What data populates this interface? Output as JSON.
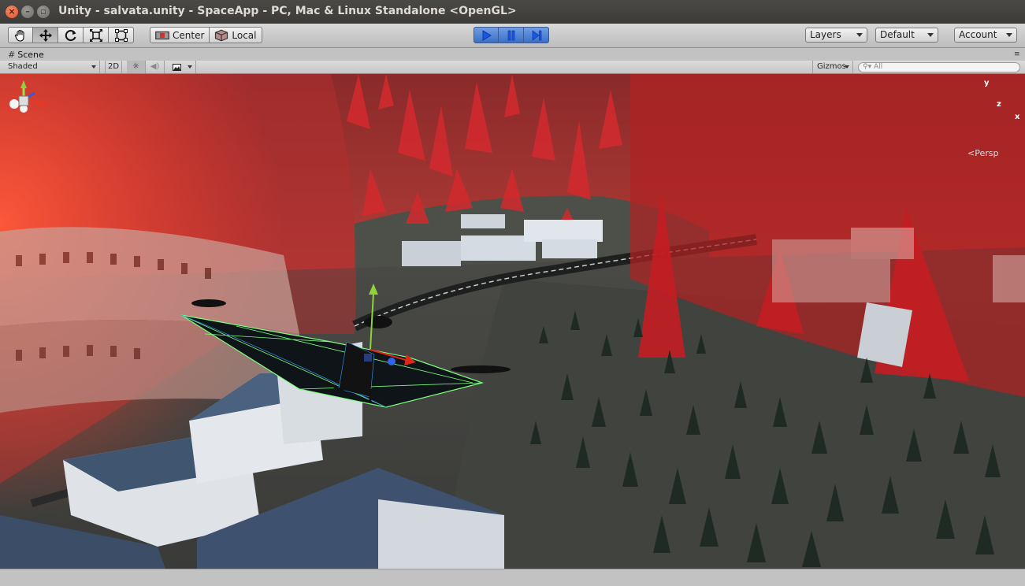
{
  "window": {
    "title": "Unity - salvata.unity - SpaceApp - PC, Mac & Linux Standalone <OpenGL>"
  },
  "toolbar": {
    "tools": [
      {
        "name": "hand-tool",
        "icon": "hand-icon"
      },
      {
        "name": "move-tool",
        "icon": "move-arrows-icon",
        "active": true
      },
      {
        "name": "rotate-tool",
        "icon": "rotate-icon"
      },
      {
        "name": "scale-tool",
        "icon": "scale-icon"
      },
      {
        "name": "rect-tool",
        "icon": "rect-icon"
      }
    ],
    "pivot_label": "Center",
    "space_label": "Local",
    "play": {
      "playing": true
    },
    "layers_label": "Layers",
    "layout_label": "Default",
    "account_label": "Account"
  },
  "scene_tab": {
    "label": "Scene"
  },
  "scene_bar": {
    "shading_mode": "Shaded",
    "mode_2d": "2D",
    "gizmos_label": "Gizmos",
    "search_placeholder": "All"
  },
  "gizmo": {
    "axes": {
      "y": "y",
      "z": "z",
      "x": "x"
    },
    "projection": "Persp"
  },
  "colors": {
    "play_active": "#3b6fc7",
    "barrier_red": "#c01e22",
    "selection_green": "#7cff7c"
  }
}
